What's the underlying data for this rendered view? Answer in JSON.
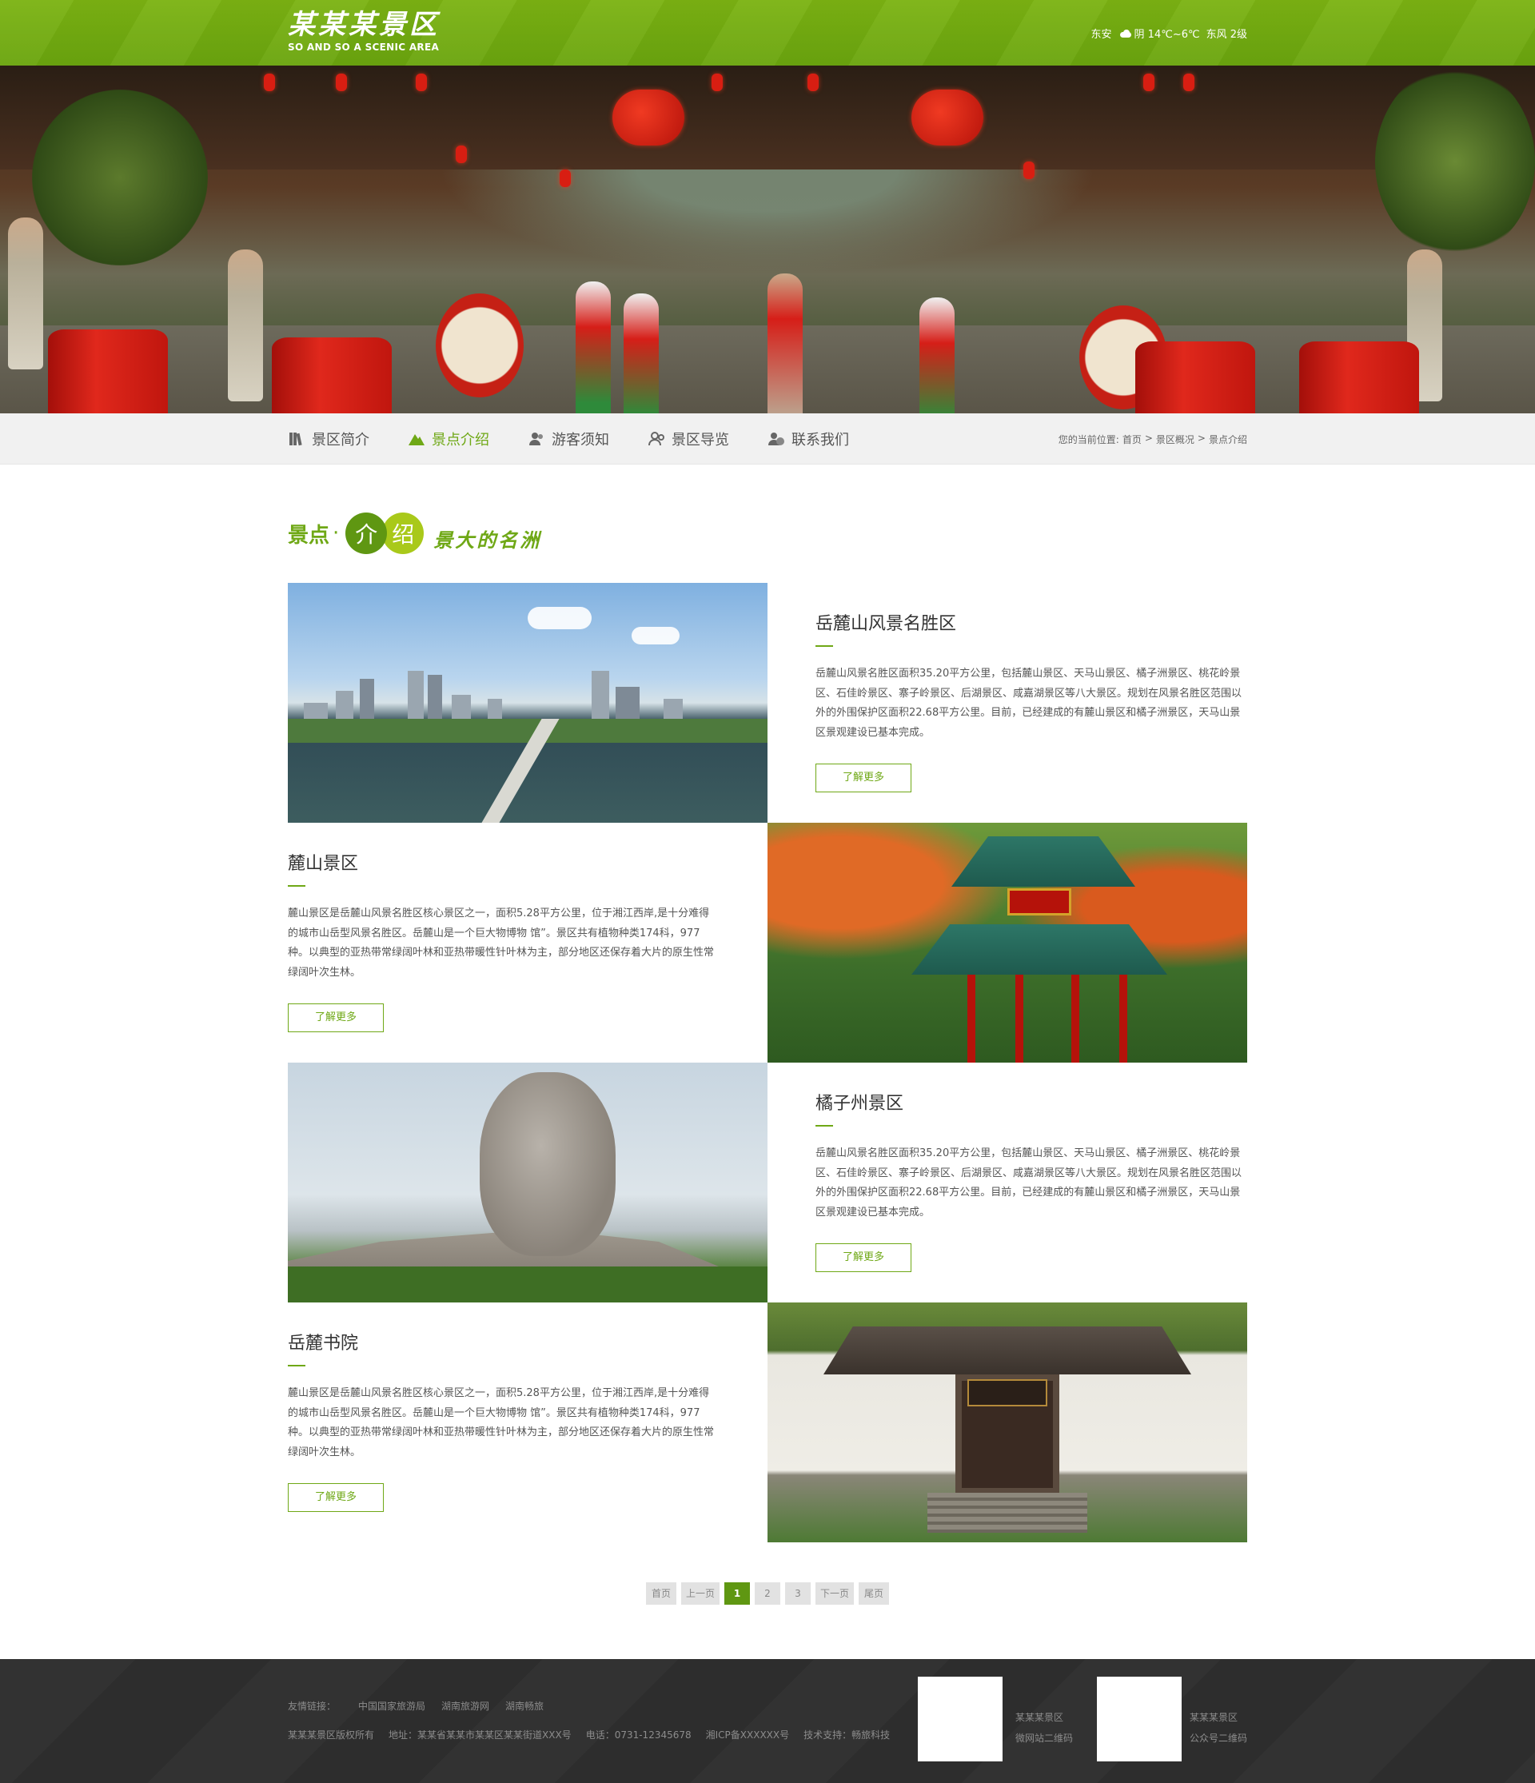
{
  "header": {
    "logo_cn": "某某某景区",
    "logo_en": "SO AND SO A SCENIC AREA",
    "weather_city": "东安",
    "weather_icon": "cloud-icon",
    "weather_desc": "阴 14℃~6℃",
    "weather_wind": "东风 2级"
  },
  "nav": {
    "items": [
      {
        "label": "景区简介",
        "icon": "books-icon"
      },
      {
        "label": "景点介绍",
        "icon": "mountain-icon"
      },
      {
        "label": "游客须知",
        "icon": "visitor-icon"
      },
      {
        "label": "景区导览",
        "icon": "guide-icon"
      },
      {
        "label": "联系我们",
        "icon": "contact-icon"
      }
    ],
    "active_index": 1,
    "breadcrumb": {
      "prefix": "您的当前位置:",
      "items": [
        "首页",
        "景区概况",
        "景点介绍"
      ],
      "sep1": ">",
      "sep2": ">"
    }
  },
  "section": {
    "title_prefix": "景点",
    "title_dot": "·",
    "circle1": "介",
    "circle2": "绍",
    "slogan": "景大的名洲"
  },
  "spots": [
    {
      "name": "岳麓山风景名胜区",
      "desc": "岳麓山风景名胜区面积35.20平方公里，包括麓山景区、天马山景区、橘子洲景区、桃花岭景区、石佳岭景区、寨子岭景区、后湖景区、咸嘉湖景区等八大景区。规划在风景名胜区范围以外的外围保护区面积22.68平方公里。目前，已经建成的有麓山景区和橘子洲景区，天马山景区景观建设已基本完成。",
      "button": "了解更多",
      "image": "city-skyline-photo"
    },
    {
      "name": "麓山景区",
      "desc": "麓山景区是岳麓山风景名胜区核心景区之一，面积5.28平方公里，位于湘江西岸,是十分难得的城市山岳型风景名胜区。岳麓山是一个巨大物博物 馆”。景区共有植物种类174科，977种。以典型的亚热带常绿阔叶林和亚热带暖性针叶林为主，部分地区还保存着大片的原生性常绿阔叶次生林。",
      "button": "了解更多",
      "image": "pavilion-photo"
    },
    {
      "name": "橘子州景区",
      "desc": "岳麓山风景名胜区面积35.20平方公里，包括麓山景区、天马山景区、橘子洲景区、桃花岭景区、石佳岭景区、寨子岭景区、后湖景区、咸嘉湖景区等八大景区。规划在风景名胜区范围以外的外围保护区面积22.68平方公里。目前，已经建成的有麓山景区和橘子洲景区，天马山景区景观建设已基本完成。",
      "button": "了解更多",
      "image": "statue-photo"
    },
    {
      "name": "岳麓书院",
      "desc": "麓山景区是岳麓山风景名胜区核心景区之一，面积5.28平方公里，位于湘江西岸,是十分难得的城市山岳型风景名胜区。岳麓山是一个巨大物博物 馆”。景区共有植物种类174科，977种。以典型的亚热带常绿阔叶林和亚热带暖性针叶林为主，部分地区还保存着大片的原生性常绿阔叶次生林。",
      "button": "了解更多",
      "image": "academy-gate-photo"
    }
  ],
  "pager": {
    "first": "首页",
    "prev": "上一页",
    "pages": [
      "1",
      "2",
      "3"
    ],
    "current": "1",
    "next": "下一页",
    "last": "尾页"
  },
  "footer": {
    "links_label": "友情链接：",
    "links": [
      "中国国家旅游局",
      "湖南旅游网",
      "湖南畅旅"
    ],
    "copyright": "某某某景区版权所有",
    "address": "地址：某某省某某市某某区某某街道XXX号",
    "phone": "电话：0731-12345678",
    "icp": "湘ICP备XXXXXX号",
    "support": "技术支持：畅旅科技",
    "qr1_line1": "某某某景区",
    "qr1_line2": "微网站二维码",
    "qr2_line1": "某某某景区",
    "qr2_line2": "公众号二维码"
  },
  "colors": {
    "accent": "#6fa816",
    "accent_dark": "#5f9712",
    "accent_light": "#a9c91a",
    "footer_bg": "#2f2f2f"
  }
}
